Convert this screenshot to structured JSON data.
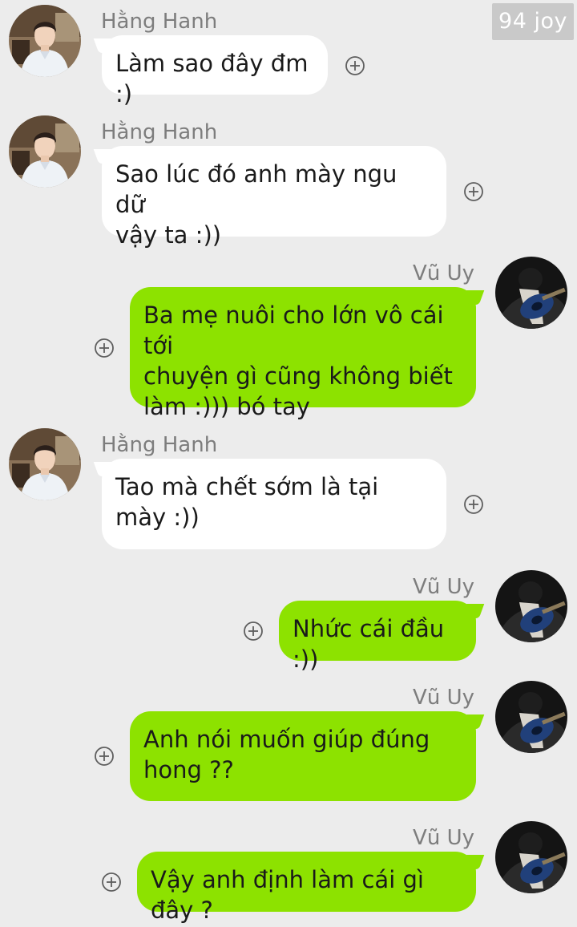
{
  "watermark": "94 joy",
  "contacts": {
    "hang": "Hằng Hanh",
    "vu": "Vũ Uy"
  },
  "messages": [
    {
      "sender": "Hằng Hanh",
      "side": "in",
      "text": "Làm sao đây đm :)"
    },
    {
      "sender": "Hằng Hanh",
      "side": "in",
      "text": "Sao lúc đó anh mày ngu dữ\nvậy ta :))"
    },
    {
      "sender": "Vũ Uy",
      "side": "out",
      "text": "Ba mẹ nuôi cho lớn vô cái tới\nchuyện gì cũng không biết\nlàm :))) bó tay"
    },
    {
      "sender": "Hằng Hanh",
      "side": "in",
      "text": "Tao mà chết sớm là tại\nmày :))"
    },
    {
      "sender": "Vũ Uy",
      "side": "out",
      "text": "Nhức cái đầu :))"
    },
    {
      "sender": "Vũ Uy",
      "side": "out",
      "text": "Anh nói muốn giúp đúng\nhong ??"
    },
    {
      "sender": "Vũ Uy",
      "side": "out",
      "text": "Vậy anh định làm cái gì đây ?"
    }
  ],
  "icons": {
    "reaction": "plus-circle-icon",
    "avatar_hang": "avatar-young-man-white-shirt",
    "avatar_vu": "avatar-guitar-player"
  },
  "colors": {
    "background": "#ececec",
    "incoming_bubble": "#ffffff",
    "outgoing_bubble": "#8de200",
    "name_text": "#7d7d7d"
  }
}
